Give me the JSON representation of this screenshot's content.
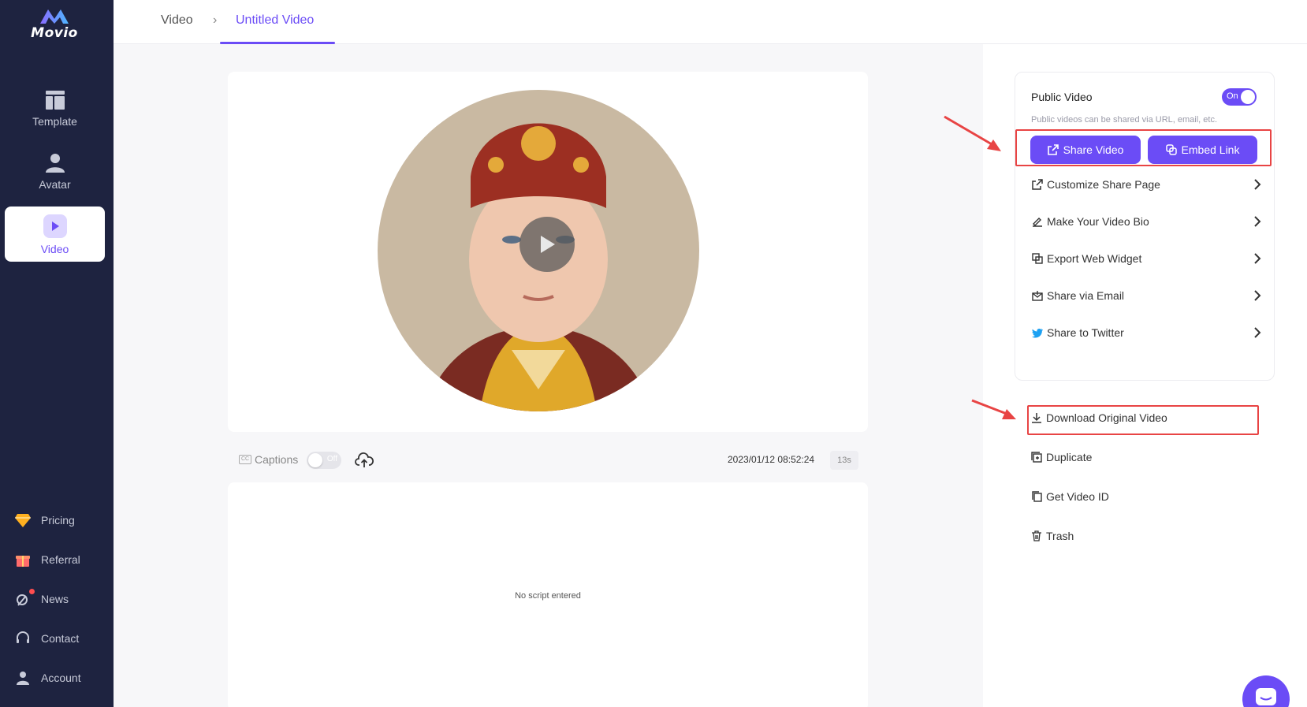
{
  "app": {
    "name": "Movio"
  },
  "sidebar": {
    "nav": [
      {
        "label": "Template",
        "icon": "template-icon"
      },
      {
        "label": "Avatar",
        "icon": "avatar-icon"
      },
      {
        "label": "Video",
        "icon": "video-play-icon",
        "active": true
      }
    ],
    "bottom": [
      {
        "label": "Pricing",
        "icon": "diamond-icon"
      },
      {
        "label": "Referral",
        "icon": "gift-icon"
      },
      {
        "label": "News",
        "icon": "satellite-icon"
      },
      {
        "label": "Contact",
        "icon": "headset-icon"
      },
      {
        "label": "Account",
        "icon": "user-icon"
      }
    ]
  },
  "breadcrumb": {
    "root": "Video",
    "separator": "›",
    "current": "Untitled Video"
  },
  "player": {
    "captions_label": "Captions",
    "captions_toggle": "Off",
    "timestamp": "2023/01/12 08:52:24",
    "duration": "13s",
    "script_placeholder": "No script entered"
  },
  "share": {
    "public_title": "Public Video",
    "public_toggle": "On",
    "public_subtitle": "Public videos can be shared via URL, email, etc.",
    "share_button": "Share Video",
    "embed_button": "Embed Link",
    "items": [
      {
        "label": "Customize Share Page",
        "icon": "external-link-icon"
      },
      {
        "label": "Make Your Video Bio",
        "icon": "signature-icon"
      },
      {
        "label": "Export Web Widget",
        "icon": "widget-icon"
      },
      {
        "label": "Share via Email",
        "icon": "email-icon"
      },
      {
        "label": "Share to Twitter",
        "icon": "twitter-icon"
      }
    ]
  },
  "actions": [
    {
      "label": "Download Original Video",
      "icon": "download-icon"
    },
    {
      "label": "Duplicate",
      "icon": "duplicate-icon"
    },
    {
      "label": "Get Video ID",
      "icon": "copy-icon"
    },
    {
      "label": "Trash",
      "icon": "trash-icon"
    }
  ],
  "colors": {
    "accent": "#6b4cf6",
    "sidebar": "#1e2340",
    "annotation": "#e84444"
  }
}
